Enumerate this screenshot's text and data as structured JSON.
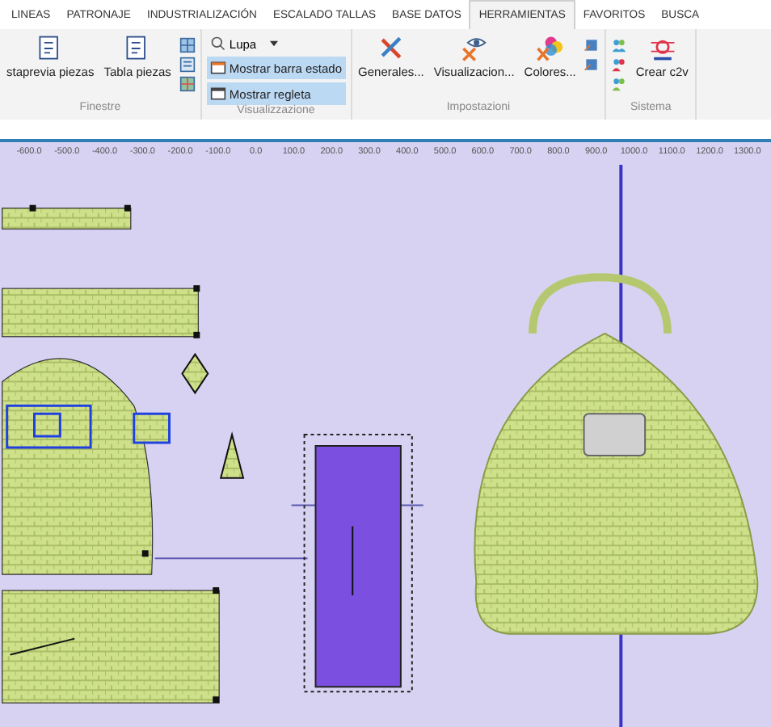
{
  "tabs": [
    {
      "label": "LINEAS",
      "selected": false
    },
    {
      "label": "PATRONAJE",
      "selected": false
    },
    {
      "label": "INDUSTRIALIZACIÓN",
      "selected": false
    },
    {
      "label": "ESCALADO TALLAS",
      "selected": false
    },
    {
      "label": "BASE DATOS",
      "selected": false
    },
    {
      "label": "HERRAMIENTAS",
      "selected": true
    },
    {
      "label": "FAVORITOS",
      "selected": false
    },
    {
      "label": "BUSCA",
      "selected": false
    }
  ],
  "ribbon": {
    "groups": [
      {
        "label": "Finestre",
        "kind": "finestre",
        "buttons": [
          {
            "label": "staprevia piezas"
          },
          {
            "label": "Tabla piezas"
          }
        ]
      },
      {
        "label": "Visualizzazione",
        "kind": "visual",
        "zoom": "Lupa",
        "toggles": [
          {
            "label": "Mostrar barra estado",
            "selected": true
          },
          {
            "label": "Mostrar regleta",
            "selected": true
          }
        ]
      },
      {
        "label": "Impostazioni",
        "kind": "settings",
        "buttons": [
          {
            "label": "Generales..."
          },
          {
            "label": "Visualizacion..."
          },
          {
            "label": "Colores..."
          }
        ]
      },
      {
        "label": "Sistema",
        "kind": "system",
        "buttons": [
          {
            "label": "Crear c2v"
          }
        ]
      }
    ]
  },
  "ruler": {
    "ticks": [
      "-600.0",
      "-500.0",
      "-400.0",
      "-300.0",
      "-200.0",
      "-100.0",
      "0.0",
      "100.0",
      "200.0",
      "300.0",
      "400.0",
      "500.0",
      "600.0",
      "700.0",
      "800.0",
      "900.0",
      "1000.0",
      "1100.0",
      "1200.0",
      "1300.0"
    ]
  }
}
